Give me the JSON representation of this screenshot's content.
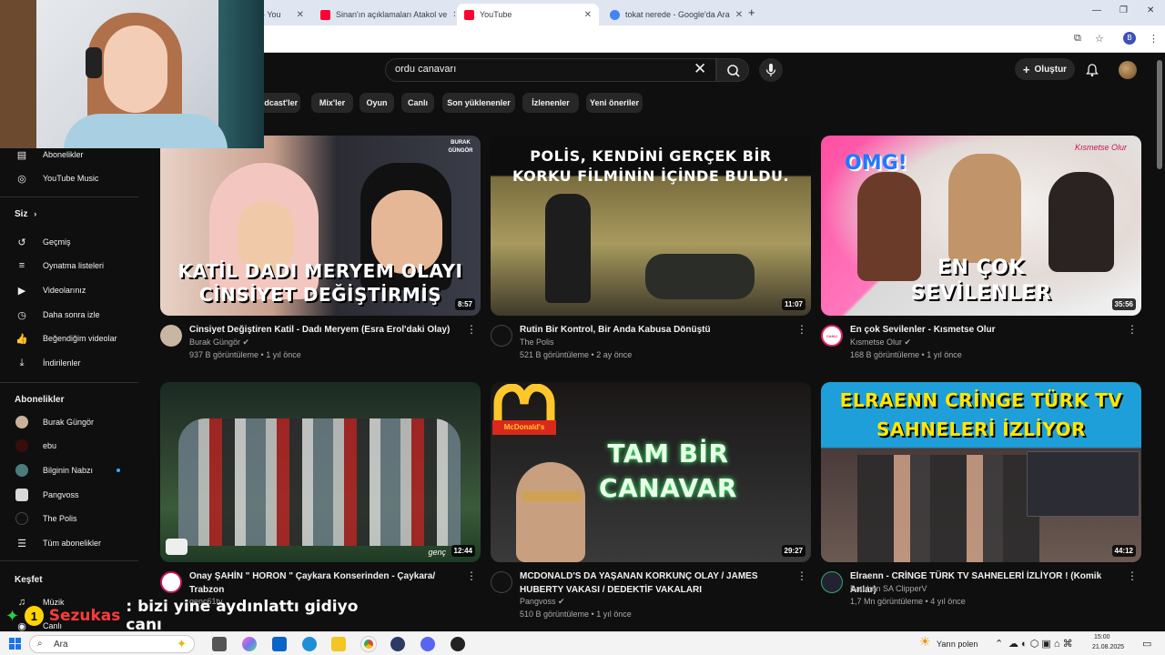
{
  "browser": {
    "tabs": [
      {
        "label": "- You",
        "active": false
      },
      {
        "label": "Sinan'ın açıklamaları Atakol ve",
        "active": false
      },
      {
        "label": "YouTube",
        "active": true
      },
      {
        "label": "tokat nerede - Google'da Ara",
        "active": false
      }
    ],
    "profile_letter": "B"
  },
  "youtube": {
    "search_value": "ordu canavarı",
    "create_label": "Oluştur",
    "chips": [
      "odcast'ler",
      "Mix'ler",
      "Oyun",
      "Canlı",
      "Son yüklenenler",
      "İzlenenler",
      "Yeni öneriler"
    ]
  },
  "sidebar": {
    "top_items": [
      {
        "label": "Abonelikler",
        "icon": "subscriptions-icon"
      },
      {
        "label": "YouTube Music",
        "icon": "youtube-music-icon"
      }
    ],
    "you_header": "Siz",
    "you_items": [
      {
        "label": "Geçmiş",
        "icon": "history-icon"
      },
      {
        "label": "Oynatma listeleri",
        "icon": "playlists-icon"
      },
      {
        "label": "Videolarınız",
        "icon": "your-videos-icon"
      },
      {
        "label": "Daha sonra izle",
        "icon": "watch-later-icon"
      },
      {
        "label": "Beğendiğim videolar",
        "icon": "liked-icon"
      },
      {
        "label": "İndirilenler",
        "icon": "downloads-icon"
      }
    ],
    "subs_header": "Abonelikler",
    "subs": [
      {
        "label": "Burak Güngör",
        "dot": false
      },
      {
        "label": "ebu",
        "dot": false
      },
      {
        "label": "Bilginin Nabzı",
        "dot": true
      },
      {
        "label": "Pangvoss",
        "dot": false
      },
      {
        "label": "The Polis",
        "dot": false
      },
      {
        "label": "Tüm abonelikler",
        "dot": false
      }
    ],
    "explore_header": "Keşfet",
    "explore_items": [
      {
        "label": "Müzik"
      },
      {
        "label": "Canlı"
      }
    ]
  },
  "videos": [
    {
      "thumb_text": "KATİL DADI MERYEM OLAYI CİNSİYET DEĞİŞTİRMİŞ",
      "corner_text": "BURAK GÜNGÖR",
      "duration": "8:57",
      "title": "Cinsiyet Değiştiren Katil - Dadı Meryem (Esra Erol'daki Olay)",
      "channel": "Burak Güngör",
      "verified": true,
      "stats": "937 B görüntüleme • 1 yıl önce"
    },
    {
      "thumb_text": "POLİS, KENDİNİ GERÇEK BİR KORKU FİLMİNİN İÇİNDE BULDU.",
      "duration": "11:07",
      "title": "Rutin Bir Kontrol, Bir Anda Kabusa Dönüştü",
      "channel": "The Polis",
      "verified": false,
      "stats": "521 B görüntüleme • 2 ay önce"
    },
    {
      "thumb_text": "EN ÇOK SEVİLENLER",
      "corner_text": "OMG!",
      "brand_text": "Kısmetse Olur",
      "duration": "35:56",
      "title": "En çok Sevilenler  - Kısmetse Olur",
      "channel": "Kısmetse Olur",
      "verified": true,
      "stats": "168 B görüntüleme • 1 yıl önce",
      "avatar_text": "CANLI"
    },
    {
      "thumb_text": "",
      "duration": "12:44",
      "title": "Onay ŞAHİN \" HORON \" Çaykara Konserinden -  Çaykara/ Trabzon",
      "channel": "genç61tv",
      "verified": false,
      "stats": "",
      "watermark": "genç"
    },
    {
      "thumb_text": "TAM BİR CANAVAR",
      "corner_text": "McDonald's",
      "duration": "29:27",
      "title": "MCDONALD'S DA YAŞANAN KORKUNÇ OLAY / JAMES HUBERTY VAKASI / DEDEKTİF VAKALARI",
      "channel": "Pangvoss",
      "verified": true,
      "stats": "510 B görüntüleme • 1 yıl önce"
    },
    {
      "thumb_text": "ELRAENN CRİNGE TÜRK TV SAHNELERİ İZLİYOR",
      "duration": "44:12",
      "title": "Elraenn - CRİNGE TÜRK TV SAHNELERİ İZLİYOR ! (Komik Anlar)",
      "channel": "Batuhan SA ClipperV",
      "verified": false,
      "stats": "1,7 Mn görüntüleme • 4 yıl önce"
    }
  ],
  "chat_overlay": {
    "badge": "1",
    "user": "Sezukas",
    "message": ": bizi yine aydınlattı gidiyo canı"
  },
  "taskbar": {
    "search_label": "Ara",
    "weather": "Yarın polen",
    "time": "15:00",
    "date": "21.08.2025"
  },
  "colors": {
    "youtube_red": "#ff0033",
    "accent_blue": "#3ea6ff",
    "bg": "#0f0f0f"
  }
}
